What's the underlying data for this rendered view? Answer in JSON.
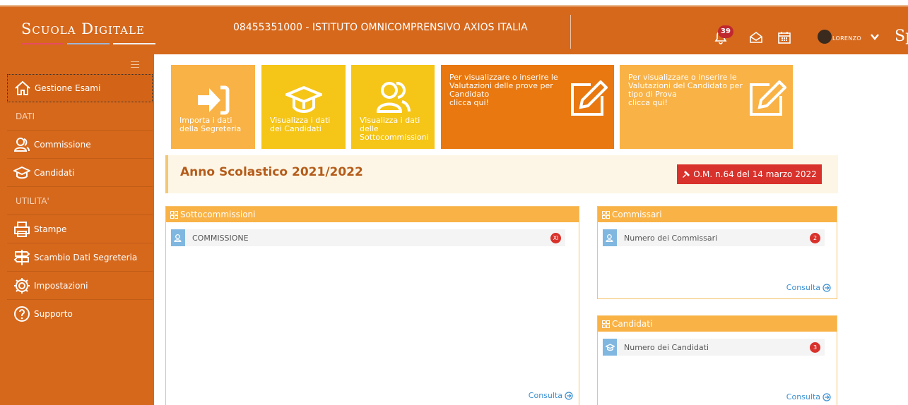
{
  "header": {
    "logo": "Scuola Digitale",
    "school": "08455351000 - ISTITUTO OMNICOMPRENSIVO AXIOS ITALIA",
    "notifications_count": "39",
    "user": "lorenzo",
    "sp_label": "Sp"
  },
  "sidebar": {
    "items": [
      {
        "label": "Gestione Esami",
        "icon": "home-icon"
      },
      {
        "section": "DATI"
      },
      {
        "label": "Commissione",
        "icon": "users-icon"
      },
      {
        "label": "Candidati",
        "icon": "graduation-cap-icon"
      },
      {
        "section": "UTILITA'"
      },
      {
        "label": "Stampe",
        "icon": "printer-icon"
      },
      {
        "label": "Scambio Dati Segreteria",
        "icon": "signpost-icon"
      },
      {
        "label": "Impostazioni",
        "icon": "gear-icon"
      },
      {
        "label": "Supporto",
        "icon": "help-icon"
      }
    ]
  },
  "tiles": {
    "import": "Importa i dati della Segreteria",
    "import_l1": "Importa i dati",
    "import_l2": "della Segreteria",
    "candidati_l1": "Visualizza i dati",
    "candidati_l2": "dei Candidati",
    "sotto_l1": "Visualizza i dati",
    "sotto_l2": "delle",
    "sotto_l3": "Sottocommissioni",
    "valutazioni_candidato_l1": "Per visualizzare o inserire le",
    "valutazioni_candidato_l2": "Valutazioni delle prove per",
    "valutazioni_candidato_l3": "Candidato",
    "valutazioni_candidato_l4": "clicca qui!",
    "valutazioni_prova_l1": "Per visualizzare o inserire le",
    "valutazioni_prova_l2": "Valutazioni del Candidato per",
    "valutazioni_prova_l3": "tipo di Prova",
    "valutazioni_prova_l4": "clicca qui!"
  },
  "year_bar": {
    "title": "Anno Scolastico 2021/2022",
    "om_button": "O.M. n.64 del 14 marzo 2022"
  },
  "panels": {
    "sottocommissioni": {
      "title": "Sottocommissioni",
      "row_label": "COMMISSIONE",
      "row_badge": "XI",
      "consulta": "Consulta"
    },
    "commissari": {
      "title": "Commissari",
      "row_label": "Numero dei Commissari",
      "row_badge": "2",
      "consulta": "Consulta"
    },
    "candidati": {
      "title": "Candidati",
      "row_label": "Numero dei Candidati",
      "row_badge": "3",
      "consulta": "Consulta"
    }
  },
  "colors": {
    "brand_orange": "#d6681c",
    "tile_light": "#f9b245",
    "tile_yellow": "#f5c518",
    "tile_dark": "#e8780f",
    "danger": "#d9312b",
    "link": "#3a8fd3"
  }
}
